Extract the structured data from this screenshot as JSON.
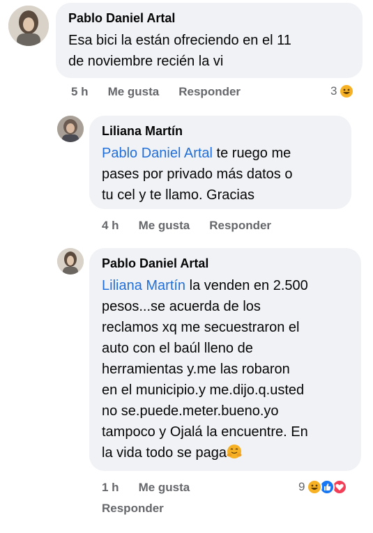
{
  "comments": [
    {
      "author": "Pablo Daniel Artal",
      "mention": "",
      "lines": [
        "Esa bici la están ofreciendo en el 11",
        "de noviembre recién la vi"
      ],
      "time": "5 h",
      "like": "Me gusta",
      "reply": "Responder",
      "reaction_count": "3",
      "reactions": [
        "haha"
      ]
    },
    {
      "author": "Liliana Martín",
      "mention": "Pablo Daniel Artal",
      "lines": [
        " te ruego me",
        "pases por privado más datos o",
        "tu cel y te llamo. Gracias"
      ],
      "time": "4 h",
      "like": "Me gusta",
      "reply": "Responder"
    },
    {
      "author": "Pablo Daniel Artal",
      "mention": "Liliana Martín",
      "lines": [
        " la venden en 2.500",
        "pesos...se acuerda de los",
        "reclamos xq me secuestraron el",
        "auto con el baúl lleno de",
        "herramientas y.me las robaron",
        "en el municipio.y me.dijo.q.usted",
        "no se.puede.meter.bueno.yo",
        "tampoco y Ojalá la encuentre. En",
        "la vida todo se paga"
      ],
      "emoji": "hugging-face",
      "time": "1 h",
      "like": "Me gusta",
      "reply": "Responder",
      "reaction_count": "9",
      "reactions": [
        "haha",
        "like",
        "love"
      ]
    }
  ],
  "colors": {
    "bubble": "#f0f2f5",
    "mention": "#216fdb",
    "meta": "#65676b",
    "like": "#1877f2",
    "love": "#f33e58",
    "haha": "#f7b125"
  }
}
